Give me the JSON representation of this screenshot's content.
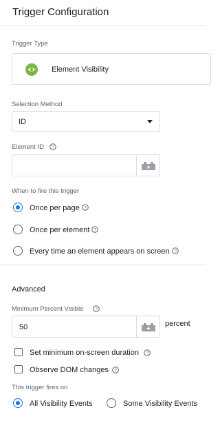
{
  "header": {
    "title": "Trigger Configuration"
  },
  "trigger_type": {
    "label": "Trigger Type",
    "value": "Element Visibility",
    "icon": "eye-icon",
    "icon_color": "#7cb342"
  },
  "selection_method": {
    "label": "Selection Method",
    "value": "ID"
  },
  "element_id": {
    "label": "Element ID",
    "value": ""
  },
  "fire": {
    "label": "When to fire this trigger",
    "options": [
      "Once per page",
      "Once per element",
      "Every time an element appears on screen"
    ],
    "selected": "Once per page"
  },
  "advanced": {
    "title": "Advanced",
    "min_percent_label": "Minimum Percent Visible",
    "min_percent_value": "50",
    "percent_unit": "percent",
    "checkbox_duration": "Set minimum on-screen duration",
    "checkbox_dom": "Observe DOM changes"
  },
  "fires_on": {
    "label": "This trigger fires on",
    "options": [
      "All Visibility Events",
      "Some Visibility Events"
    ],
    "selected": "All Visibility Events"
  },
  "colors": {
    "accent": "#1a73e8",
    "border": "#dadce0",
    "muted": "#5f6368"
  }
}
